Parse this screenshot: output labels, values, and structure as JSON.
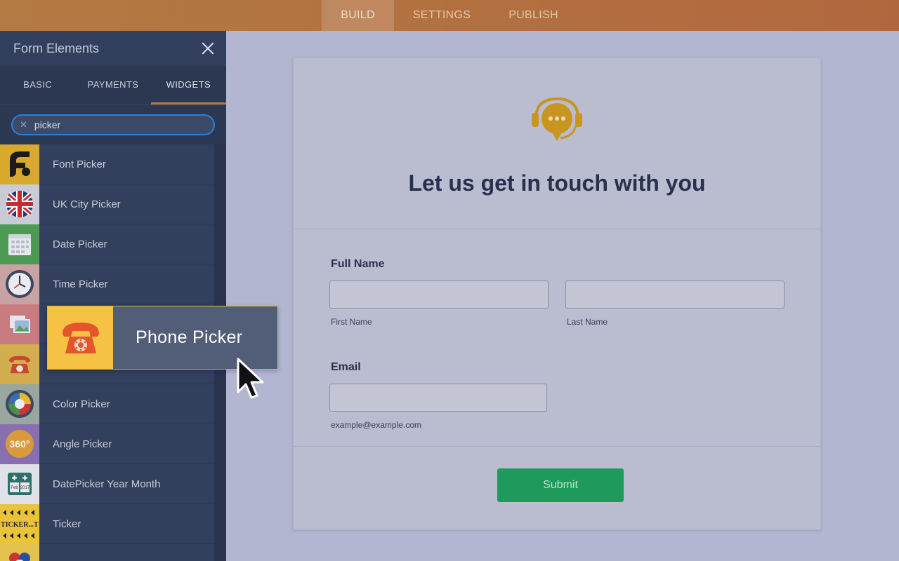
{
  "nav": {
    "tabs": [
      "BUILD",
      "SETTINGS",
      "PUBLISH"
    ],
    "active": "BUILD"
  },
  "panel": {
    "title": "Form Elements",
    "tabs": [
      "BASIC",
      "PAYMENTS",
      "WIDGETS"
    ],
    "active_tab": "WIDGETS",
    "search": {
      "value": "picker"
    },
    "items": [
      {
        "label": "Font Picker",
        "icon": "font-picker-icon"
      },
      {
        "label": "UK City Picker",
        "icon": "uk-flag-icon"
      },
      {
        "label": "Date Picker",
        "icon": "calendar-icon"
      },
      {
        "label": "Time Picker",
        "icon": "clock-icon"
      },
      {
        "label": "",
        "icon": "image-picker-icon"
      },
      {
        "label": "",
        "icon": "telephone-icon"
      },
      {
        "label": "Color Picker",
        "icon": "color-wheel-icon"
      },
      {
        "label": "Angle Picker",
        "icon": "angle-360-icon"
      },
      {
        "label": "DatePicker Year Month",
        "icon": "year-month-calendar-icon"
      },
      {
        "label": "Ticker",
        "icon": "ticker-icon"
      },
      {
        "label": "",
        "icon": "flags-icon"
      }
    ]
  },
  "drag_ghost": {
    "label": "Phone Picker",
    "icon": "telephone-icon"
  },
  "form": {
    "heading": "Let us get in touch with you",
    "full_name_label": "Full Name",
    "first_name_sub": "First Name",
    "last_name_sub": "Last Name",
    "email_label": "Email",
    "email_sub": "example@example.com",
    "submit_label": "Submit"
  },
  "icon_texts": {
    "angle": "360°",
    "ticker": "TICKER...T",
    "calendar_month": "Feb",
    "calendar_year": "2017"
  },
  "colors": {
    "accent": "#c0733e",
    "topbar": "#b1673d",
    "panel": "#33405d",
    "submit": "#1e9b5c",
    "support_icon": "#c8951f",
    "ghost_icon_bg": "#f5c244"
  }
}
